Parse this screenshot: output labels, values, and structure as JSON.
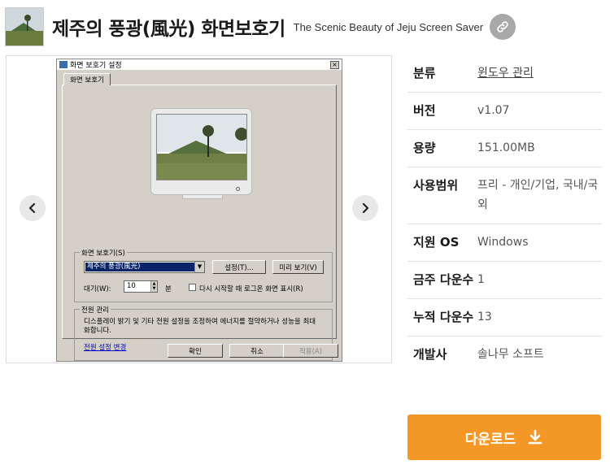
{
  "header": {
    "title": "제주의 풍광(風光) 화면보호기",
    "subtitle": "The Scenic Beauty of Jeju Screen Saver"
  },
  "dialog": {
    "title": "화면 보호기 설정",
    "close": "×",
    "tab": "화면 보호기",
    "screensaver_group": "화면 보호기(S)",
    "selected_screensaver": "제주의 풍광(風光)",
    "settings_button": "설정(T)...",
    "preview_button": "미리 보기(V)",
    "wait_label": "대기(W):",
    "wait_value": "10",
    "wait_unit": "분",
    "resume_checkbox": "다시 시작할 때 로그온 화면 표시(R)",
    "power_group": "전원 관리",
    "power_text": "디스플레이 밝기 및 기타 전원 설정을 조정하여 에너지를 절약하거나 성능을 최대화합니다.",
    "power_link": "전원 설정 변경",
    "ok_button": "확인",
    "cancel_button": "취소",
    "apply_button": "적용(A)"
  },
  "info": [
    {
      "key": "분류",
      "value": "윈도우 관리",
      "link": true
    },
    {
      "key": "버전",
      "value": "v1.07"
    },
    {
      "key": "용량",
      "value": "151.00MB"
    },
    {
      "key": "사용범위",
      "value": "프리 - 개인/기업, 국내/국외"
    },
    {
      "key": "지원 OS",
      "value": "Windows"
    },
    {
      "key": "금주 다운수",
      "value": "1"
    },
    {
      "key": "누적 다운수",
      "value": "13"
    },
    {
      "key": "개발사",
      "value": "솔나무 소프트"
    }
  ],
  "download_label": "다운로드",
  "colors": {
    "accent": "#f39826",
    "selection": "#0a246a",
    "dialog_bg": "#d4d0c8"
  },
  "icons": {
    "link": "link-icon",
    "prev": "chevron-left-icon",
    "next": "chevron-right-icon",
    "download": "download-icon"
  }
}
